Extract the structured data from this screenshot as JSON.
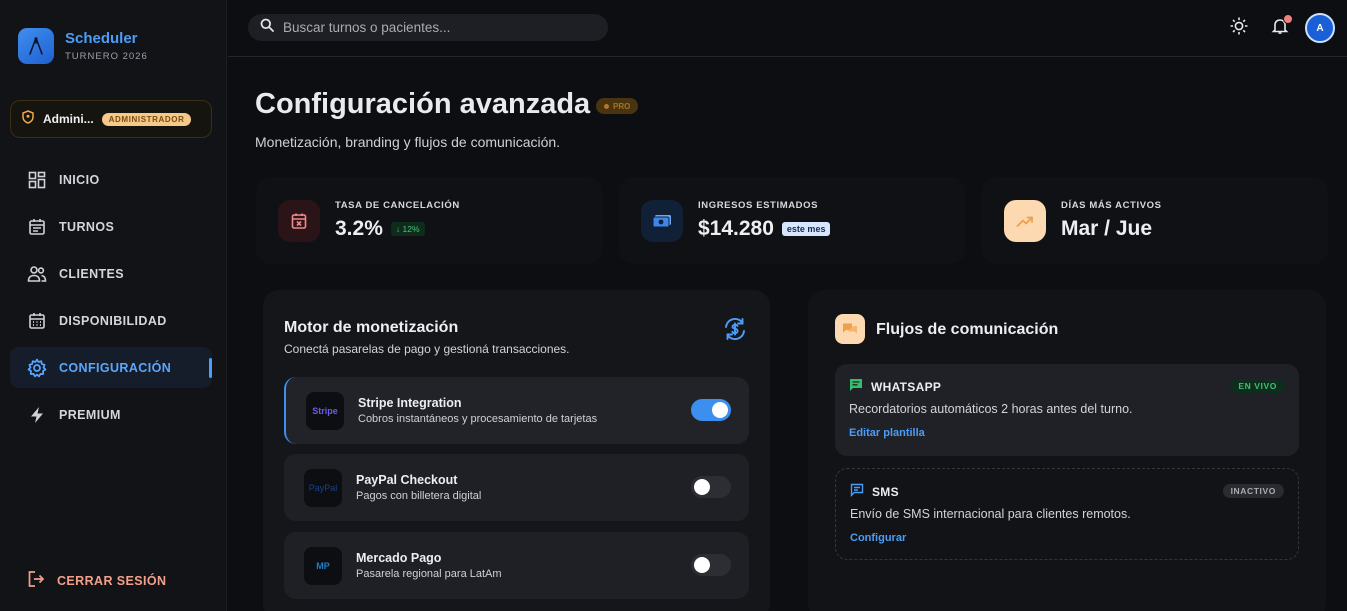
{
  "app": {
    "name": "Scheduler",
    "subtitle": "TURNERO 2026"
  },
  "user": {
    "name": "Admini...",
    "role": "ADMINISTRADOR",
    "avatar_initial": "A"
  },
  "nav": [
    {
      "label": "INICIO",
      "icon": "grid-icon"
    },
    {
      "label": "TURNOS",
      "icon": "calendar-list-icon"
    },
    {
      "label": "CLIENTES",
      "icon": "users-icon"
    },
    {
      "label": "DISPONIBILIDAD",
      "icon": "calendar-grid-icon"
    },
    {
      "label": "CONFIGURACIÓN",
      "icon": "gear-icon",
      "active": true
    },
    {
      "label": "PREMIUM",
      "icon": "lightning-icon"
    }
  ],
  "logout_label": "CERRAR SESIÓN",
  "search": {
    "placeholder": "Buscar turnos o pacientes..."
  },
  "header": {
    "title": "Configuración avanzada",
    "badge": "PRO",
    "subtitle": "Monetización, branding y flujos de comunicación."
  },
  "stats": [
    {
      "label": "TASA DE CANCELACIÓN",
      "value": "3.2%",
      "chip": "↓ 12%"
    },
    {
      "label": "INGRESOS ESTIMADOS",
      "value": "$14.280",
      "chip": "este mes"
    },
    {
      "label": "DÍAS MÁS ACTIVOS",
      "value": "Mar / Jue"
    }
  ],
  "monetization": {
    "title": "Motor de monetización",
    "subtitle": "Conectá pasarelas de pago y gestioná transacciones.",
    "gateways": [
      {
        "logo": "Stripe",
        "name": "Stripe Integration",
        "description": "Cobros instantáneos y procesamiento de tarjetas",
        "enabled": true
      },
      {
        "logo": "PayPal",
        "name": "PayPal Checkout",
        "description": "Pagos con billetera digital",
        "enabled": false
      },
      {
        "logo": "MP",
        "name": "Mercado Pago",
        "description": "Pasarela regional para LatAm",
        "enabled": false
      }
    ]
  },
  "communication": {
    "title": "Flujos de comunicación",
    "flows": [
      {
        "name": "WHATSAPP",
        "status": "EN VIVO",
        "description": "Recordatorios automáticos 2 horas antes del turno.",
        "action": "Editar plantilla"
      },
      {
        "name": "SMS",
        "status": "INACTIVO",
        "description": "Envío de SMS internacional para clientes remotos.",
        "action": "Configurar"
      }
    ]
  }
}
